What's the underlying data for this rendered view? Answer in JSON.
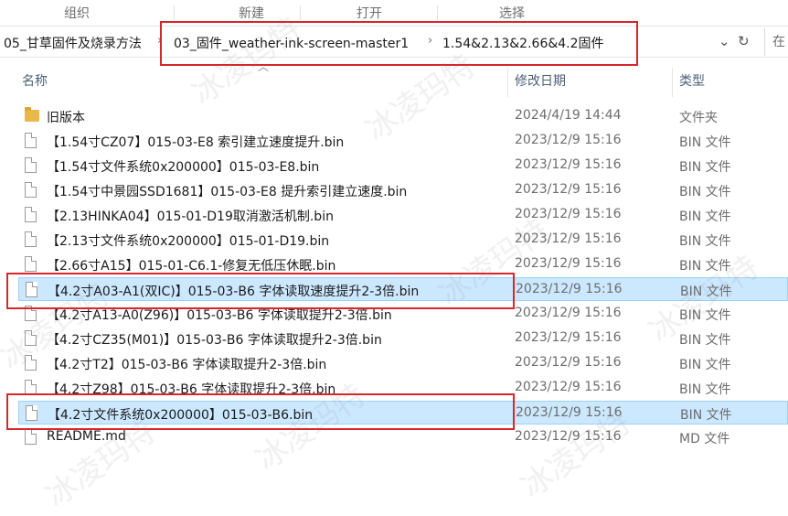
{
  "ribbon": {
    "groups": [
      "组织",
      "新建",
      "打开",
      "选择"
    ]
  },
  "address": {
    "crumbs": [
      "05_甘草固件及烧录方法",
      "03_固件_weather-ink-screen-master1",
      "1.54&2.13&2.66&4.2固件"
    ],
    "search_prefix": "在"
  },
  "columns": {
    "name": "名称",
    "date": "修改日期",
    "type": "类型"
  },
  "files": [
    {
      "name": "旧版本",
      "date": "2024/4/19 14:44",
      "type": "文件夹",
      "kind": "folder-icon"
    },
    {
      "name": "【1.54寸CZ07】015-03-E8 索引建立速度提升.bin",
      "date": "2023/12/9 15:16",
      "type": "BIN 文件",
      "kind": "file-icon"
    },
    {
      "name": "【1.54寸文件系统0x200000】015-03-E8.bin",
      "date": "2023/12/9 15:16",
      "type": "BIN 文件",
      "kind": "file-icon"
    },
    {
      "name": "【1.54寸中景园SSD1681】015-03-E8 提升索引建立速度.bin",
      "date": "2023/12/9 15:16",
      "type": "BIN 文件",
      "kind": "file-icon"
    },
    {
      "name": "【2.13HINKA04】015-01-D19取消激活机制.bin",
      "date": "2023/12/9 15:16",
      "type": "BIN 文件",
      "kind": "file-icon"
    },
    {
      "name": "【2.13寸文件系统0x200000】015-01-D19.bin",
      "date": "2023/12/9 15:16",
      "type": "BIN 文件",
      "kind": "file-icon"
    },
    {
      "name": "【2.66寸A15】015-01-C6.1-修复无低压休眠.bin",
      "date": "2023/12/9 15:16",
      "type": "BIN 文件",
      "kind": "file-icon"
    },
    {
      "name": "【4.2寸A03-A1(双IC)】015-03-B6 字体读取速度提升2-3倍.bin",
      "date": "2023/12/9 15:16",
      "type": "BIN 文件",
      "kind": "file-icon",
      "selected": true
    },
    {
      "name": "【4.2寸A13-A0(Z96)】015-03-B6 字体读取提升2-3倍.bin",
      "date": "2023/12/9 15:16",
      "type": "BIN 文件",
      "kind": "file-icon"
    },
    {
      "name": "【4.2寸CZ35(M01)】015-03-B6 字体读取提升2-3倍.bin",
      "date": "2023/12/9 15:16",
      "type": "BIN 文件",
      "kind": "file-icon"
    },
    {
      "name": "【4.2寸T2】015-03-B6 字体读取提升2-3倍.bin",
      "date": "2023/12/9 15:16",
      "type": "BIN 文件",
      "kind": "file-icon"
    },
    {
      "name": "【4.2寸Z98】015-03-B6 字体读取提升2-3倍.bin",
      "date": "2023/12/9 15:16",
      "type": "BIN 文件",
      "kind": "file-icon"
    },
    {
      "name": "【4.2寸文件系统0x200000】015-03-B6.bin",
      "date": "2023/12/9 15:16",
      "type": "BIN 文件",
      "kind": "file-icon",
      "selected": true
    },
    {
      "name": "README.md",
      "date": "2023/12/9 15:16",
      "type": "MD 文件",
      "kind": "file-icon"
    }
  ],
  "watermark": "冰凌玛特",
  "colors": {
    "selection": "#cce8ff",
    "highlight_box": "#d9262c",
    "folder": "#e8b84a"
  }
}
